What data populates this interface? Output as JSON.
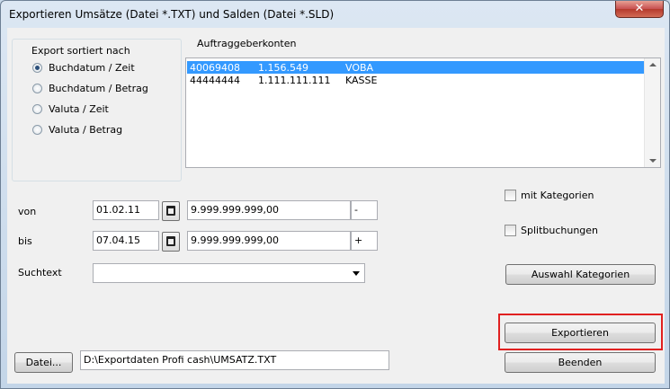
{
  "window": {
    "title": "Exportieren Umsätze (Datei *.TXT) und Salden (Datei *.SLD)",
    "close_label": "✕"
  },
  "sort_group": {
    "label": "Export sortiert nach",
    "options": [
      {
        "label": "Buchdatum / Zeit",
        "checked": true
      },
      {
        "label": "Buchdatum / Betrag",
        "checked": false
      },
      {
        "label": "Valuta / Zeit",
        "checked": false
      },
      {
        "label": "Valuta / Betrag",
        "checked": false
      }
    ]
  },
  "accounts": {
    "label": "Auftraggeberkonten",
    "rows": [
      {
        "number": "40069408",
        "amount": "1.156.549",
        "name": "VOBA",
        "selected": true
      },
      {
        "number": "44444444",
        "amount": "1.111.111.111",
        "name": "KASSE",
        "selected": false
      }
    ]
  },
  "filters": {
    "from_label": "von",
    "from_date": "01.02.11",
    "from_amount": "9.999.999.999,00",
    "from_sign": "-",
    "to_label": "bis",
    "to_date": "07.04.15",
    "to_amount": "9.999.999.999,00",
    "to_sign": "+",
    "search_label": "Suchtext",
    "search_value": ""
  },
  "options": {
    "categories_label": "mit Kategorien",
    "split_label": "Splitbuchungen",
    "select_categories_button": "Auswahl Kategorien"
  },
  "file": {
    "button_label": "Datei...",
    "path": "D:\\Exportdaten Profi cash\\UMSATZ.TXT"
  },
  "actions": {
    "export_button": "Exportieren",
    "exit_button": "Beenden"
  }
}
